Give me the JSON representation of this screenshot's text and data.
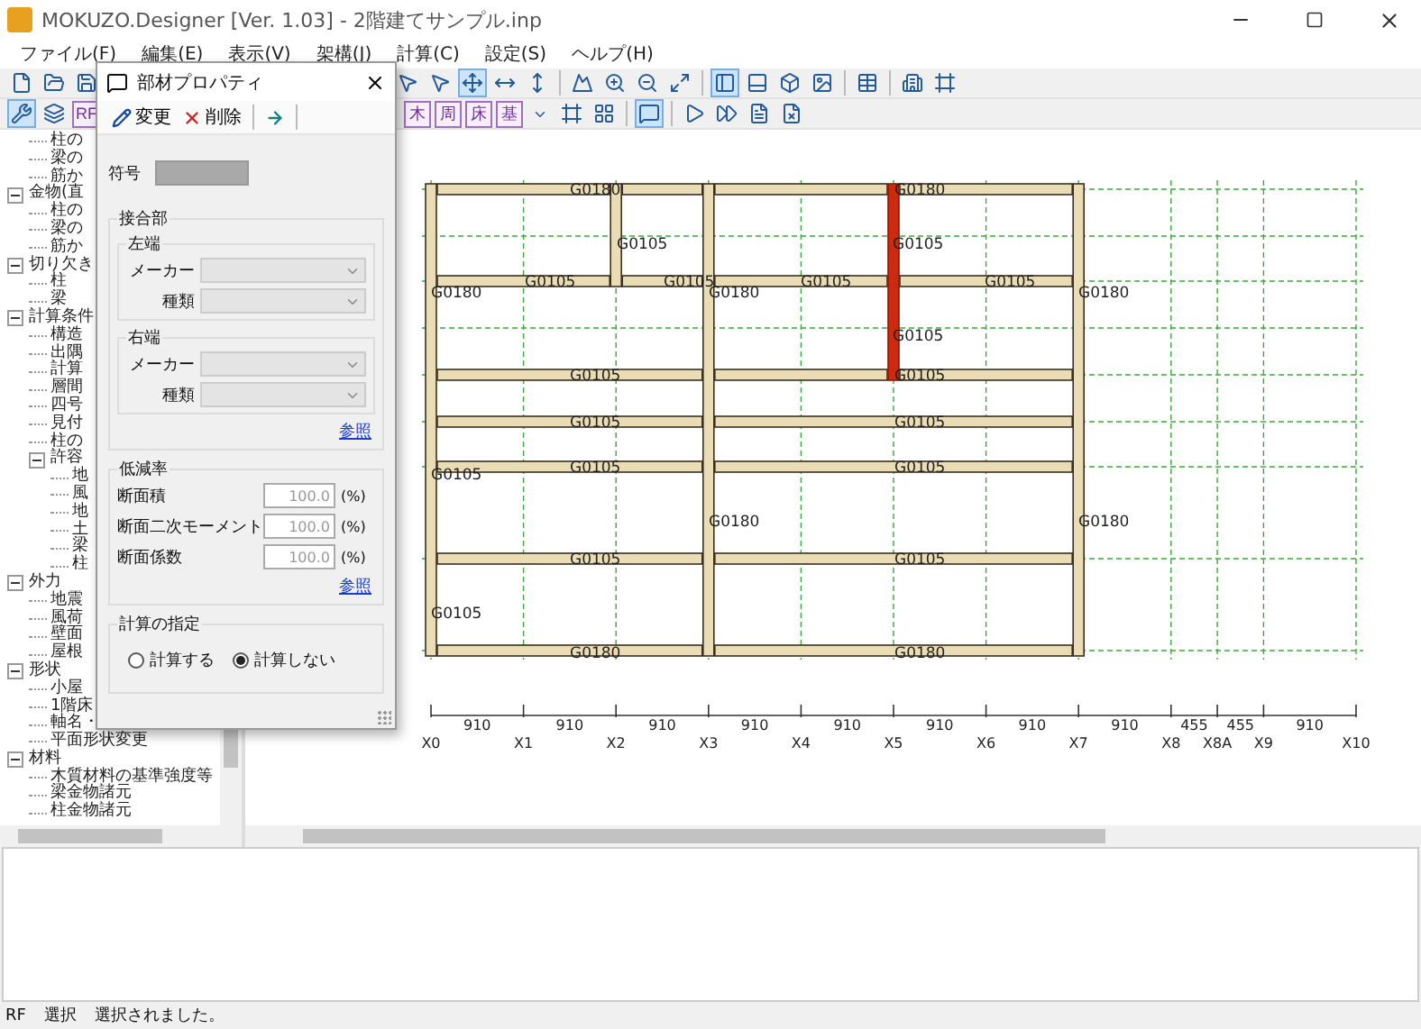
{
  "window": {
    "title": "MOKUZO.Designer [Ver. 1.03] - 2階建てサンプル.inp"
  },
  "menu": [
    "ファイル(F)",
    "編集(E)",
    "表示(V)",
    "架構(J)",
    "計算(C)",
    "設定(S)",
    "ヘルプ(H)"
  ],
  "toolbar_1": {
    "left": [
      {
        "kind": "new",
        "selected": false
      },
      {
        "kind": "open",
        "selected": false
      },
      {
        "kind": "save",
        "selected": false
      }
    ],
    "right": [
      {
        "kind": "pointer",
        "selected": false
      },
      {
        "kind": "pointer",
        "selected": false
      },
      {
        "kind": "movexy",
        "selected": true
      },
      {
        "kind": "movex",
        "selected": false
      },
      {
        "kind": "movey",
        "selected": false
      },
      {
        "kind": "separator"
      },
      {
        "kind": "image",
        "selected": false
      },
      {
        "kind": "zoomin",
        "selected": false
      },
      {
        "kind": "zoomout",
        "selected": false
      },
      {
        "kind": "fit",
        "selected": false
      },
      {
        "kind": "separator"
      },
      {
        "kind": "panel",
        "selected": true
      },
      {
        "kind": "split",
        "selected": false
      },
      {
        "kind": "cube",
        "selected": false
      },
      {
        "kind": "picture",
        "selected": false
      },
      {
        "kind": "separator"
      },
      {
        "kind": "table",
        "selected": false
      },
      {
        "kind": "separator"
      },
      {
        "kind": "building",
        "selected": false
      },
      {
        "kind": "frame",
        "selected": false
      }
    ]
  },
  "toolbar_2": {
    "left": [
      {
        "kind": "tool",
        "selected": true
      },
      {
        "kind": "layers",
        "selected": false
      },
      {
        "kind": "text",
        "label": "RF",
        "selected": false
      }
    ],
    "right": [
      {
        "kind": "text",
        "label": "木",
        "selected": false
      },
      {
        "kind": "text",
        "label": "周",
        "selected": false
      },
      {
        "kind": "text",
        "label": "床",
        "selected": false
      },
      {
        "kind": "text",
        "label": "基",
        "selected": false
      },
      {
        "kind": "caret",
        "selected": false
      },
      {
        "kind": "frame",
        "selected": false
      },
      {
        "kind": "grid",
        "selected": false
      },
      {
        "kind": "separator"
      },
      {
        "kind": "comment",
        "selected": true
      },
      {
        "kind": "separator"
      },
      {
        "kind": "play",
        "selected": false
      },
      {
        "kind": "forward",
        "selected": false
      },
      {
        "kind": "document",
        "selected": false
      },
      {
        "kind": "report",
        "selected": false
      }
    ]
  },
  "tree": [
    {
      "children": [
        {
          "label": "柱の"
        },
        {
          "label": "梁の"
        },
        {
          "label": "筋か"
        }
      ]
    },
    {
      "label": "金物(直",
      "expanded": true,
      "children": [
        {
          "label": "柱の"
        },
        {
          "label": "梁の"
        },
        {
          "label": "筋か"
        }
      ]
    },
    {
      "label": "切り欠き",
      "expanded": true,
      "children": [
        {
          "label": "柱"
        },
        {
          "label": "梁"
        }
      ]
    },
    {
      "label": "計算条件",
      "expanded": true,
      "children": [
        {
          "label": "構造"
        },
        {
          "label": "出隅"
        },
        {
          "label": "計算"
        },
        {
          "label": "層間"
        },
        {
          "label": "四号"
        },
        {
          "label": "見付"
        },
        {
          "label": "柱の"
        },
        {
          "label": "許容",
          "expanded": true,
          "children": [
            {
              "label": "地"
            },
            {
              "label": "風"
            },
            {
              "label": "地"
            },
            {
              "label": "土"
            },
            {
              "label": "梁"
            },
            {
              "label": "柱"
            }
          ]
        }
      ]
    },
    {
      "label": "外力",
      "expanded": true,
      "children": [
        {
          "label": "地震"
        },
        {
          "label": "風荷"
        },
        {
          "label": "壁面"
        },
        {
          "label": "屋根"
        }
      ]
    },
    {
      "label": "形状",
      "expanded": true,
      "children": [
        {
          "label": "小屋"
        },
        {
          "label": "1階床"
        },
        {
          "label": "軸名・"
        },
        {
          "label": "平面形状変更"
        }
      ]
    },
    {
      "label": "材料",
      "expanded": true,
      "children": [
        {
          "label": "木質材料の基準強度等"
        },
        {
          "label": "梁金物諸元"
        },
        {
          "label": "柱金物諸元"
        }
      ]
    }
  ],
  "plan": {
    "grid": {
      "lines": [
        "X0",
        "X1",
        "X2",
        "X3",
        "X4",
        "X5",
        "X6",
        "X7",
        "X8",
        "X8A",
        "X9",
        "X10"
      ],
      "spans": [
        "910",
        "910",
        "910",
        "910",
        "910",
        "910",
        "910",
        "910",
        "455",
        "455",
        "910"
      ]
    },
    "members": [
      {
        "labels": [
          "G0180"
        ],
        "selected": false
      },
      {
        "labels": [
          "G0180"
        ],
        "selected": false
      },
      {
        "labels": [
          "G0105"
        ],
        "selected": false
      },
      {
        "labels": [
          "G0105"
        ],
        "selected": false
      },
      {
        "labels": [
          "G0105",
          "G0105"
        ],
        "selected": false
      },
      {
        "labels": [
          "G0105"
        ],
        "selected": false
      },
      {
        "labels": [
          "G0105"
        ],
        "selected": false
      },
      {
        "labels": [
          "G0105"
        ],
        "selected": false
      },
      {
        "labels": [
          "G0105"
        ],
        "selected": false
      },
      {
        "labels": [
          "G0105"
        ],
        "selected": false
      },
      {
        "labels": [
          "G0105"
        ],
        "selected": false
      },
      {
        "labels": [
          "G0105"
        ],
        "selected": false
      },
      {
        "labels": [
          "G0105"
        ],
        "selected": false
      },
      {
        "labels": [
          "G0180"
        ],
        "selected": false
      },
      {
        "labels": [
          "G0180"
        ],
        "selected": false
      },
      {
        "labels": [
          "G0180",
          "G0105",
          "G0105"
        ],
        "selected": false
      },
      {
        "labels": [
          "G0105"
        ],
        "selected": false
      },
      {
        "labels": [
          "G0180",
          "G0180"
        ],
        "selected": false
      },
      {
        "labels": [
          "G0105",
          "G0105"
        ],
        "selected": true
      },
      {
        "labels": [
          "G0180",
          "G0180"
        ],
        "selected": false
      }
    ]
  },
  "dialog": {
    "title": "部材プロパティ",
    "actions": [
      {
        "kind": "edit",
        "label": "変更"
      },
      {
        "kind": "delete",
        "label": "削除"
      },
      {
        "kind": "arrow"
      }
    ],
    "symbol": {
      "label": "符号",
      "disabled": true
    },
    "joint": {
      "title": "接合部",
      "ends": [
        {
          "title": "左端",
          "fields": [
            {
              "label": "メーカー",
              "disabled": true
            },
            {
              "label": "種類",
              "disabled": true
            }
          ]
        },
        {
          "title": "右端",
          "fields": [
            {
              "label": "メーカー",
              "disabled": true
            },
            {
              "label": "種類",
              "disabled": true
            }
          ]
        }
      ],
      "link": "参照"
    },
    "reduction": {
      "title": "低減率",
      "rows": [
        {
          "label": "断面積",
          "value": "100.0",
          "unit": "(%)"
        },
        {
          "label": "断面二次モーメント",
          "value": "100.0",
          "unit": "(%)"
        },
        {
          "label": "断面係数",
          "value": "100.0",
          "unit": "(%)"
        }
      ],
      "link": "参照"
    },
    "calculation": {
      "title": "計算の指定",
      "options": [
        {
          "label": "計算する",
          "selected": false
        },
        {
          "label": "計算しない",
          "selected": true
        }
      ]
    }
  },
  "status_bar": [
    "RF",
    "選択",
    "選択されました。"
  ]
}
